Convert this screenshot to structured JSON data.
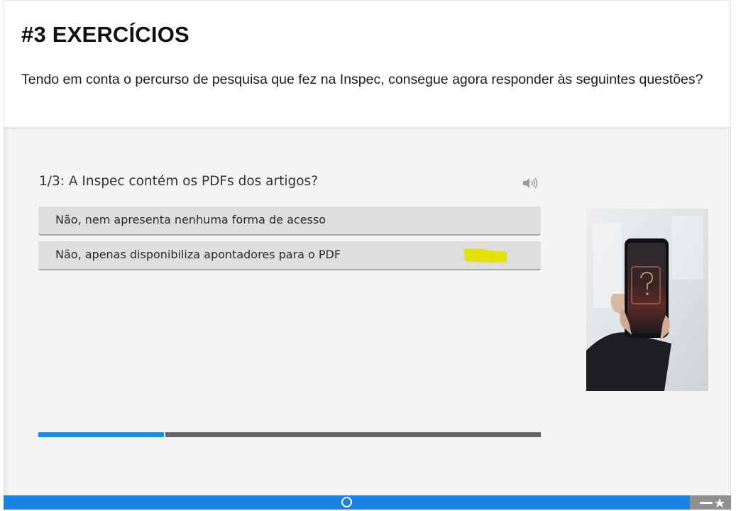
{
  "header": {
    "title": "#3 EXERCÍCIOS",
    "intro": "Tendo em conta o percurso de pesquisa que fez na Inspec, consegue agora responder às seguintes questões?"
  },
  "quiz": {
    "question": "1/3: A Inspec contém os PDFs dos artigos?",
    "audio_icon": "speaker-icon",
    "options": [
      {
        "label": "Não, nem apresenta nenhuma forma de acesso"
      },
      {
        "label": "Não, apenas disponibiliza apontadores para o PDF"
      }
    ],
    "progress_fraction": 0.25,
    "image": "hand-holding-phone-question-mark"
  },
  "footer": {
    "nav_icon": "circle-dot-icon",
    "right_icon": "star-rating-icon"
  },
  "colors": {
    "accent_blue": "#1a8fe3",
    "highlight_yellow": "#e1e000",
    "quiz_bg": "#f4f4f4",
    "option_bg": "#dedede"
  }
}
